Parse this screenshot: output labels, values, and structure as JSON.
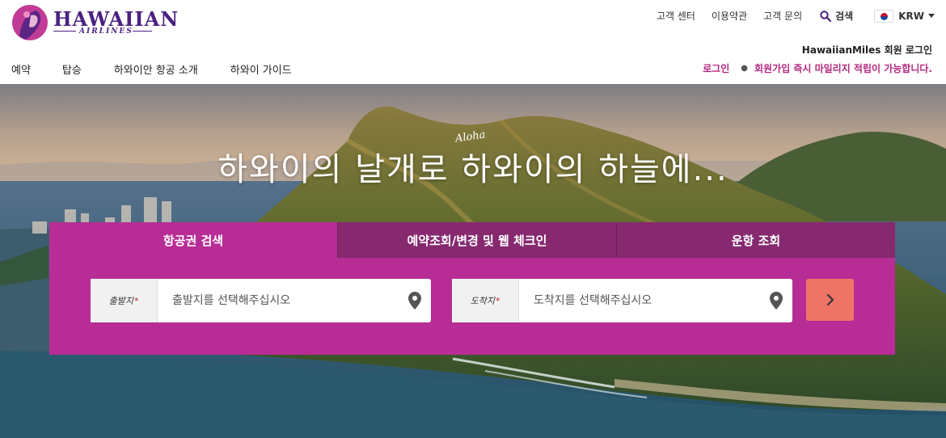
{
  "brand": {
    "name": "HAWAIIAN",
    "sub": "AIRLINES",
    "colors": {
      "purple": "#4a2180",
      "magenta": "#b72d95",
      "accent": "#b3287f",
      "go": "#ef7468"
    }
  },
  "utility": {
    "customer_center": "고객 센터",
    "terms": "이용약관",
    "contact": "고객 문의",
    "search": "검색",
    "currency": "KRW"
  },
  "miles_login": "HawaiianMiles 회원 로그인",
  "nav": [
    "예약",
    "탑승",
    "하와이안 항공 소개",
    "하와이 가이드"
  ],
  "member": {
    "login": "로그인",
    "message": "회원가입 즉시 마일리지 적립이 가능합니다."
  },
  "hero": {
    "script_word": "Aloha",
    "headline": "하와이의 날개로 하와이의 하늘에..."
  },
  "booking": {
    "tabs": [
      "항공권 검색",
      "예약조회/변경 및 웹 체크인",
      "운항 조회"
    ],
    "origin": {
      "label": "출발지",
      "placeholder": "출발지를 선택해주십시오"
    },
    "destination": {
      "label": "도착지",
      "placeholder": "도착지를 선택해주십시오"
    },
    "required_mark": "*",
    "icons": {
      "field": "location-pin-icon",
      "go": "chevron-right-icon"
    }
  }
}
